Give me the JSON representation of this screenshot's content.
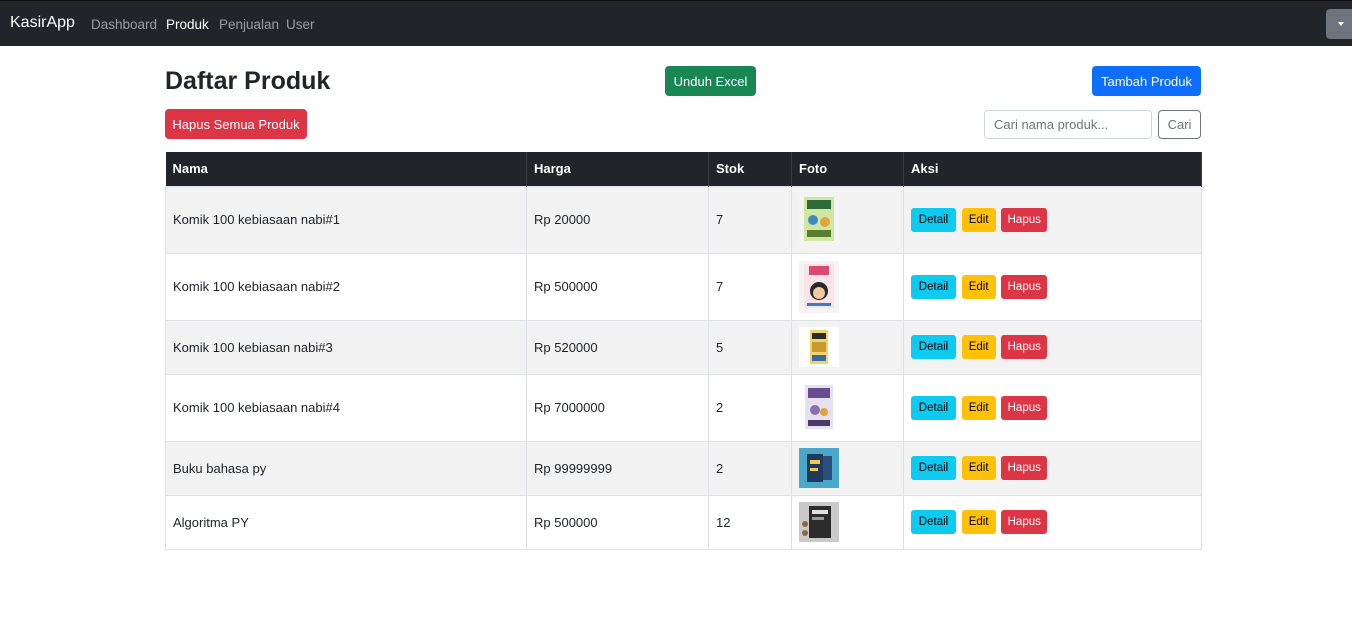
{
  "navbar": {
    "brand": "KasirApp",
    "links": [
      "Dashboard",
      "Produk",
      "Penjualan",
      "User"
    ],
    "active": "Produk"
  },
  "page": {
    "title": "Daftar Produk",
    "excel_label": "Unduh Excel",
    "tambah_label": "Tambah Produk",
    "hapus_semua_label": "Hapus Semua Produk",
    "search_placeholder": "Cari nama produk...",
    "search_button": "Cari"
  },
  "table": {
    "headers": [
      "Nama",
      "Harga",
      "Stok",
      "Foto",
      "Aksi"
    ],
    "actions": {
      "detail": "Detail",
      "edit": "Edit",
      "hapus": "Hapus"
    },
    "rows": [
      {
        "nama": "Komik 100 kebiasaan nabi#1",
        "harga": "Rp 20000",
        "stok": "7",
        "foto": "comic-cover-1"
      },
      {
        "nama": "Komik 100 kebiasaan nabi#2",
        "harga": "Rp 500000",
        "stok": "7",
        "foto": "comic-cover-2"
      },
      {
        "nama": "Komik 100 kebiasan nabi#3",
        "harga": "Rp 520000",
        "stok": "5",
        "foto": "comic-cover-3"
      },
      {
        "nama": "Komik 100 kebiasaan nabi#4",
        "harga": "Rp 7000000",
        "stok": "2",
        "foto": "comic-cover-4"
      },
      {
        "nama": "Buku bahasa py",
        "harga": "Rp 99999999",
        "stok": "2",
        "foto": "python-book-cover"
      },
      {
        "nama": "Algoritma PY",
        "harga": "Rp 500000",
        "stok": "12",
        "foto": "algorithm-book-cover"
      }
    ]
  },
  "colors": {
    "navbar": "#212529",
    "success": "#198754",
    "primary": "#0d6efd",
    "danger": "#dc3545",
    "info": "#0dcaf0",
    "warning": "#ffc107"
  }
}
